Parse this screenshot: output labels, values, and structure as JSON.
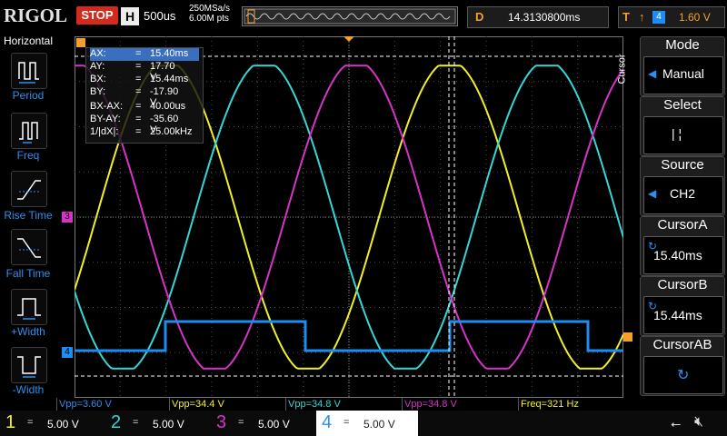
{
  "topbar": {
    "brand": "RIGOL",
    "run_state": "STOP",
    "horizontal_badge": "H",
    "timebase": "500us",
    "sample_rate": "250MSa/s",
    "memory_depth": "6.00M pts",
    "delay_label": "D",
    "delay_value": "14.3130800ms",
    "trigger_label": "T",
    "trigger_edge_icon": "rising-edge-icon",
    "trigger_source": "4",
    "trigger_level": "1.60 V"
  },
  "leftbar": {
    "title": "Horizontal",
    "buttons": [
      {
        "label": "Period",
        "icon": "period-icon"
      },
      {
        "label": "Freq",
        "icon": "freq-icon"
      },
      {
        "label": "Rise Time",
        "icon": "rise-time-icon"
      },
      {
        "label": "Fall Time",
        "icon": "fall-time-icon"
      },
      {
        "label": "+Width",
        "icon": "pos-width-icon"
      },
      {
        "label": "-Width",
        "icon": "neg-width-icon"
      }
    ]
  },
  "readout": {
    "rows": [
      {
        "k": "AX:",
        "v": "15.40ms"
      },
      {
        "k": "AY:",
        "v": "17.70 V"
      },
      {
        "k": "BX:",
        "v": "15.44ms"
      },
      {
        "k": "BY:",
        "v": "-17.90 V"
      },
      {
        "k": "BX-AX:",
        "v": "40.00us"
      },
      {
        "k": "BY-AY:",
        "v": "-35.60 V"
      },
      {
        "k": "1/|dX|:",
        "v": "25.00kHz"
      }
    ],
    "eq": "="
  },
  "measurements": [
    {
      "text": "Vpp=3.60 V",
      "color": "#2d8ff0"
    },
    {
      "text": "Vpp=34.4 V",
      "color": "#f2ef2a"
    },
    {
      "text": "Vpp=34.8 V",
      "color": "#36d6d6"
    },
    {
      "text": "Vpp=34.8 V",
      "color": "#d634c8"
    },
    {
      "text": "Freq=321 Hz",
      "color": "#f2ef2a"
    }
  ],
  "channels": [
    {
      "num": "1",
      "coupling": "=",
      "scale": "5.00 V",
      "color": "#f2ef2a"
    },
    {
      "num": "2",
      "coupling": "=",
      "scale": "5.00 V",
      "color": "#36d6d6"
    },
    {
      "num": "3",
      "coupling": "=",
      "scale": "5.00 V",
      "color": "#d634c8"
    },
    {
      "num": "4",
      "coupling": "=",
      "scale": "5.00 V",
      "color": "#2d8ff0"
    }
  ],
  "status_icons": [
    "usb-icon",
    "speaker-mute-icon"
  ],
  "rightpanel": {
    "side_tab": "Cursor",
    "mode": {
      "label": "Mode",
      "value": "Manual"
    },
    "select": {
      "label": "Select",
      "value": "|  ¦"
    },
    "source": {
      "label": "Source",
      "value": "CH2"
    },
    "cursorA": {
      "label": "CursorA",
      "value": "15.40ms"
    },
    "cursorB": {
      "label": "CursorB",
      "value": "15.44ms"
    },
    "cursorAB": {
      "label": "CursorAB",
      "value": ""
    }
  },
  "markers": {
    "ch3": "3",
    "ch4": "4"
  },
  "colors": {
    "ch1": "#f2ef2a",
    "ch2": "#36d6d6",
    "ch3": "#d634c8",
    "ch4": "#1e8cf0",
    "grid": "#4a4a4a",
    "cursor": "#ffffff"
  }
}
